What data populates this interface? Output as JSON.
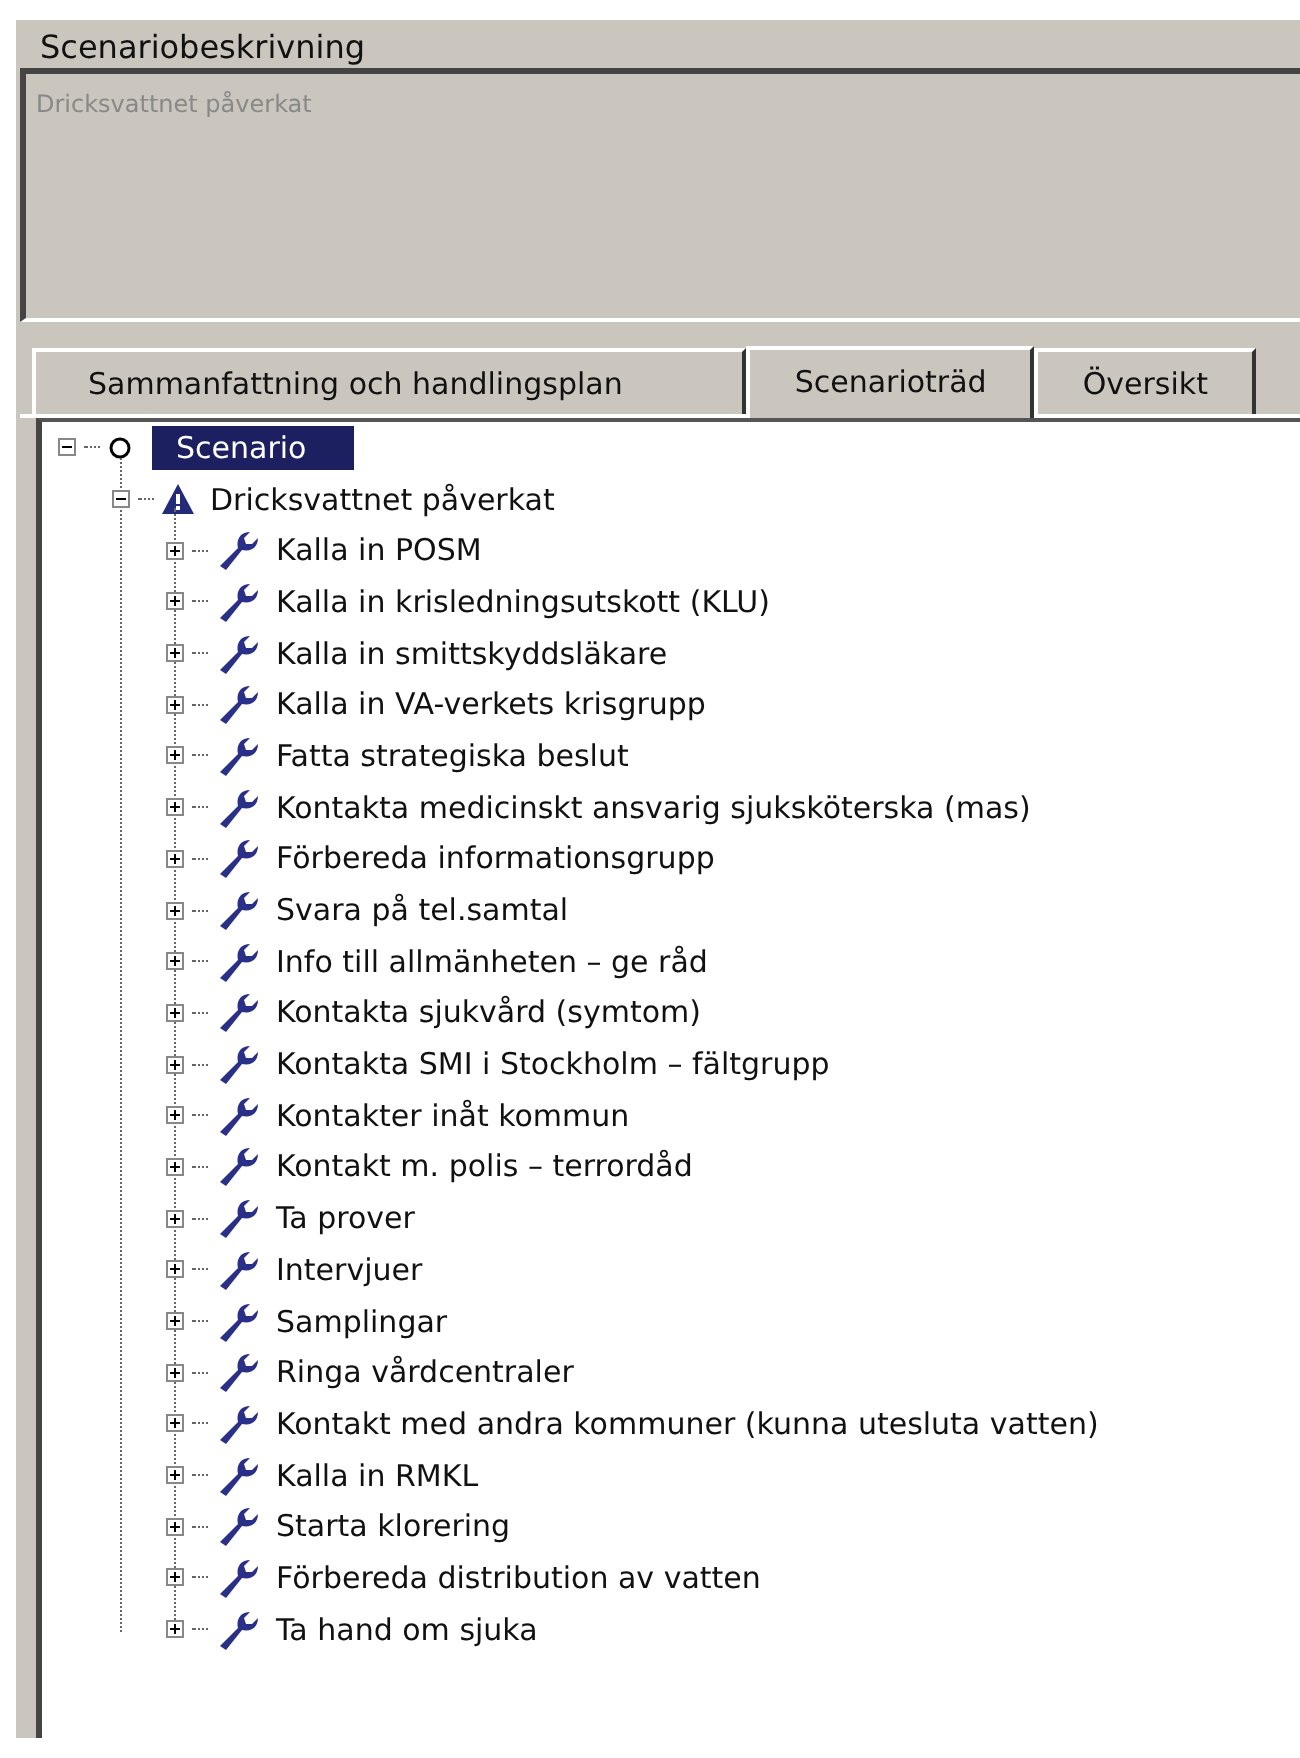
{
  "description": {
    "title": "Scenariobeskrivning",
    "value": "Dricksvattnet påverkat"
  },
  "tabs": [
    {
      "label": "Sammanfattning och handlingsplan",
      "selected": false
    },
    {
      "label": "Scenarioträd",
      "selected": true
    },
    {
      "label": "Översikt",
      "selected": false
    }
  ],
  "tree": [
    {
      "label": "Scenario",
      "kind": "circle",
      "expanded": true,
      "selected": true,
      "children": [
        {
          "label": "Dricksvattnet påverkat",
          "kind": "warning",
          "expanded": true,
          "selected": false,
          "children": [
            {
              "label": "Kalla in POSM",
              "kind": "wrench",
              "expanded": false,
              "selected": false
            },
            {
              "label": "Kalla in krisledningsutskott (KLU)",
              "kind": "wrench",
              "expanded": false,
              "selected": false
            },
            {
              "label": "Kalla in smittskyddsläkare",
              "kind": "wrench",
              "expanded": false,
              "selected": false
            },
            {
              "label": "Kalla in VA-verkets krisgrupp",
              "kind": "wrench",
              "expanded": false,
              "selected": false
            },
            {
              "label": "Fatta strategiska beslut",
              "kind": "wrench",
              "expanded": false,
              "selected": false
            },
            {
              "label": "Kontakta medicinskt ansvarig sjuksköterska (mas)",
              "kind": "wrench",
              "expanded": false,
              "selected": false
            },
            {
              "label": "Förbereda informationsgrupp",
              "kind": "wrench",
              "expanded": false,
              "selected": false
            },
            {
              "label": "Svara på tel.samtal",
              "kind": "wrench",
              "expanded": false,
              "selected": false
            },
            {
              "label": "Info till allmänheten – ge råd",
              "kind": "wrench",
              "expanded": false,
              "selected": false
            },
            {
              "label": "Kontakta sjukvård (symtom)",
              "kind": "wrench",
              "expanded": false,
              "selected": false
            },
            {
              "label": "Kontakta SMI i Stockholm – fältgrupp",
              "kind": "wrench",
              "expanded": false,
              "selected": false
            },
            {
              "label": "Kontakter inåt kommun",
              "kind": "wrench",
              "expanded": false,
              "selected": false
            },
            {
              "label": "Kontakt m. polis – terrordåd",
              "kind": "wrench",
              "expanded": false,
              "selected": false
            },
            {
              "label": "Ta prover",
              "kind": "wrench",
              "expanded": false,
              "selected": false
            },
            {
              "label": "Intervjuer",
              "kind": "wrench",
              "expanded": false,
              "selected": false
            },
            {
              "label": "Samplingar",
              "kind": "wrench",
              "expanded": false,
              "selected": false
            },
            {
              "label": "Ringa vårdcentraler",
              "kind": "wrench",
              "expanded": false,
              "selected": false
            },
            {
              "label": "Kontakt med andra kommuner (kunna utesluta vatten)",
              "kind": "wrench",
              "expanded": false,
              "selected": false
            },
            {
              "label": "Kalla in RMKL",
              "kind": "wrench",
              "expanded": false,
              "selected": false
            },
            {
              "label": "Starta klorering",
              "kind": "wrench",
              "expanded": false,
              "selected": false
            },
            {
              "label": "Förbereda distribution av vatten",
              "kind": "wrench",
              "expanded": false,
              "selected": false
            },
            {
              "label": "Ta hand om sjuka",
              "kind": "wrench",
              "expanded": false,
              "selected": false
            }
          ]
        }
      ]
    }
  ]
}
